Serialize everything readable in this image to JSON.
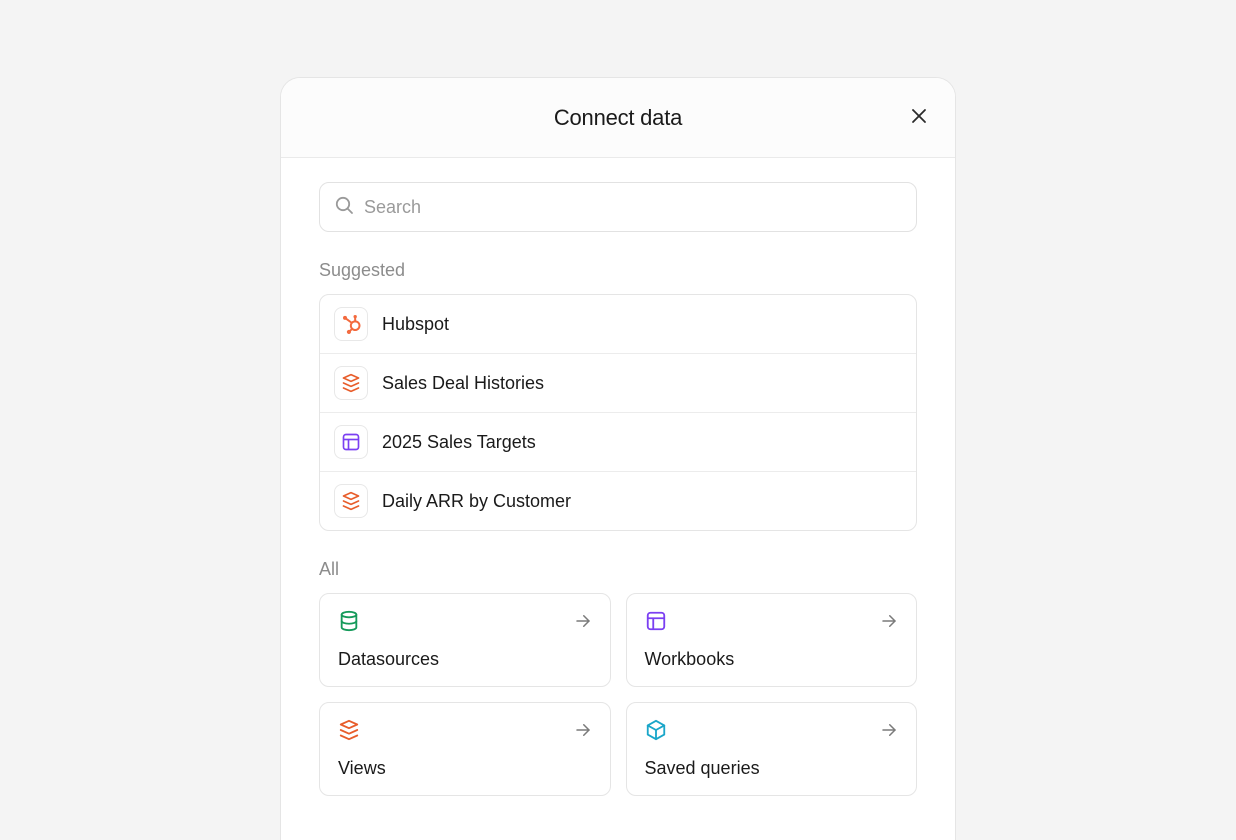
{
  "modal": {
    "title": "Connect data",
    "search": {
      "placeholder": "Search"
    },
    "suggested": {
      "label": "Suggested",
      "items": [
        {
          "label": "Hubspot",
          "icon": "hubspot"
        },
        {
          "label": "Sales Deal Histories",
          "icon": "views"
        },
        {
          "label": "2025 Sales Targets",
          "icon": "workbook"
        },
        {
          "label": "Daily ARR by Customer",
          "icon": "views"
        }
      ]
    },
    "all": {
      "label": "All",
      "items": [
        {
          "label": "Datasources",
          "icon": "datasource"
        },
        {
          "label": "Workbooks",
          "icon": "workbook"
        },
        {
          "label": "Views",
          "icon": "views"
        },
        {
          "label": "Saved queries",
          "icon": "cube"
        }
      ]
    }
  }
}
